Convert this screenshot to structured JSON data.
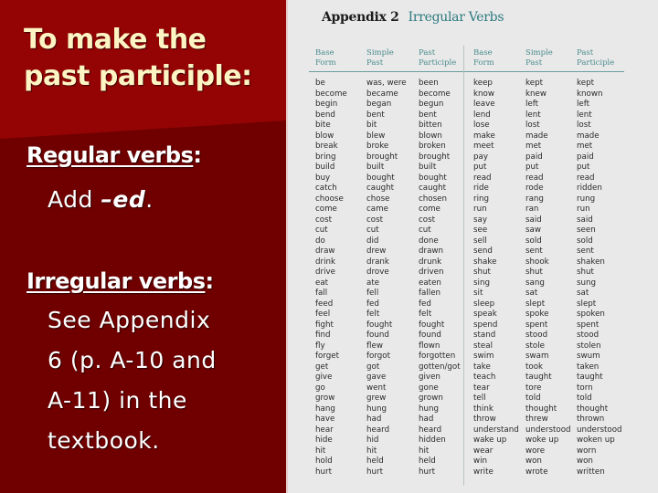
{
  "slide": {
    "title": "To make the past participle:",
    "regular": {
      "heading": "Regular verbs",
      "colon": ":",
      "text_prefix": "Add ",
      "suffix": "–ed",
      "text_end": "."
    },
    "irregular": {
      "heading": "Irregular verbs",
      "colon": ":",
      "lines": [
        "See Appendix",
        "6 (p. A-10 and",
        "A-11) in the",
        "textbook."
      ]
    },
    "colors": {
      "background": "#700000",
      "band": "#940404",
      "title_color": "#fdf4c4",
      "page_bg": "#e9e9e9",
      "accent_teal": "#2d7a80"
    }
  },
  "appendix": {
    "label": "Appendix 2",
    "subtitle": "Irregular Verbs",
    "headers": [
      "Base\nForm",
      "Simple\nPast",
      "Past\nParticiple",
      "Base\nForm",
      "Simple\nPast",
      "Past\nParticiple"
    ],
    "left_table": [
      [
        "be",
        "was, were",
        "been"
      ],
      [
        "become",
        "became",
        "become"
      ],
      [
        "begin",
        "began",
        "begun"
      ],
      [
        "bend",
        "bent",
        "bent"
      ],
      [
        "bite",
        "bit",
        "bitten"
      ],
      [
        "blow",
        "blew",
        "blown"
      ],
      [
        "break",
        "broke",
        "broken"
      ],
      [
        "bring",
        "brought",
        "brought"
      ],
      [
        "build",
        "built",
        "built"
      ],
      [
        "buy",
        "bought",
        "bought"
      ],
      [
        "catch",
        "caught",
        "caught"
      ],
      [
        "choose",
        "chose",
        "chosen"
      ],
      [
        "come",
        "came",
        "come"
      ],
      [
        "cost",
        "cost",
        "cost"
      ],
      [
        "cut",
        "cut",
        "cut"
      ],
      [
        "do",
        "did",
        "done"
      ],
      [
        "draw",
        "drew",
        "drawn"
      ],
      [
        "drink",
        "drank",
        "drunk"
      ],
      [
        "drive",
        "drove",
        "driven"
      ],
      [
        "eat",
        "ate",
        "eaten"
      ],
      [
        "fall",
        "fell",
        "fallen"
      ],
      [
        "feed",
        "fed",
        "fed"
      ],
      [
        "feel",
        "felt",
        "felt"
      ],
      [
        "fight",
        "fought",
        "fought"
      ],
      [
        "find",
        "found",
        "found"
      ],
      [
        "fly",
        "flew",
        "flown"
      ],
      [
        "forget",
        "forgot",
        "forgotten"
      ],
      [
        "get",
        "got",
        "gotten/got"
      ],
      [
        "give",
        "gave",
        "given"
      ],
      [
        "go",
        "went",
        "gone"
      ],
      [
        "grow",
        "grew",
        "grown"
      ],
      [
        "hang",
        "hung",
        "hung"
      ],
      [
        "have",
        "had",
        "had"
      ],
      [
        "hear",
        "heard",
        "heard"
      ],
      [
        "hide",
        "hid",
        "hidden"
      ],
      [
        "hit",
        "hit",
        "hit"
      ],
      [
        "hold",
        "held",
        "held"
      ],
      [
        "hurt",
        "hurt",
        "hurt"
      ]
    ],
    "right_table": [
      [
        "keep",
        "kept",
        "kept"
      ],
      [
        "know",
        "knew",
        "known"
      ],
      [
        "leave",
        "left",
        "left"
      ],
      [
        "lend",
        "lent",
        "lent"
      ],
      [
        "lose",
        "lost",
        "lost"
      ],
      [
        "make",
        "made",
        "made"
      ],
      [
        "meet",
        "met",
        "met"
      ],
      [
        "pay",
        "paid",
        "paid"
      ],
      [
        "put",
        "put",
        "put"
      ],
      [
        "read",
        "read",
        "read"
      ],
      [
        "ride",
        "rode",
        "ridden"
      ],
      [
        "ring",
        "rang",
        "rung"
      ],
      [
        "run",
        "ran",
        "run"
      ],
      [
        "say",
        "said",
        "said"
      ],
      [
        "see",
        "saw",
        "seen"
      ],
      [
        "sell",
        "sold",
        "sold"
      ],
      [
        "send",
        "sent",
        "sent"
      ],
      [
        "shake",
        "shook",
        "shaken"
      ],
      [
        "shut",
        "shut",
        "shut"
      ],
      [
        "sing",
        "sang",
        "sung"
      ],
      [
        "sit",
        "sat",
        "sat"
      ],
      [
        "sleep",
        "slept",
        "slept"
      ],
      [
        "speak",
        "spoke",
        "spoken"
      ],
      [
        "spend",
        "spent",
        "spent"
      ],
      [
        "stand",
        "stood",
        "stood"
      ],
      [
        "steal",
        "stole",
        "stolen"
      ],
      [
        "swim",
        "swam",
        "swum"
      ],
      [
        "take",
        "took",
        "taken"
      ],
      [
        "teach",
        "taught",
        "taught"
      ],
      [
        "tear",
        "tore",
        "torn"
      ],
      [
        "tell",
        "told",
        "told"
      ],
      [
        "think",
        "thought",
        "thought"
      ],
      [
        "throw",
        "threw",
        "thrown"
      ],
      [
        "understand",
        "understood",
        "understood"
      ],
      [
        "wake up",
        "woke up",
        "woken up"
      ],
      [
        "wear",
        "wore",
        "worn"
      ],
      [
        "win",
        "won",
        "won"
      ],
      [
        "write",
        "wrote",
        "written"
      ]
    ]
  }
}
